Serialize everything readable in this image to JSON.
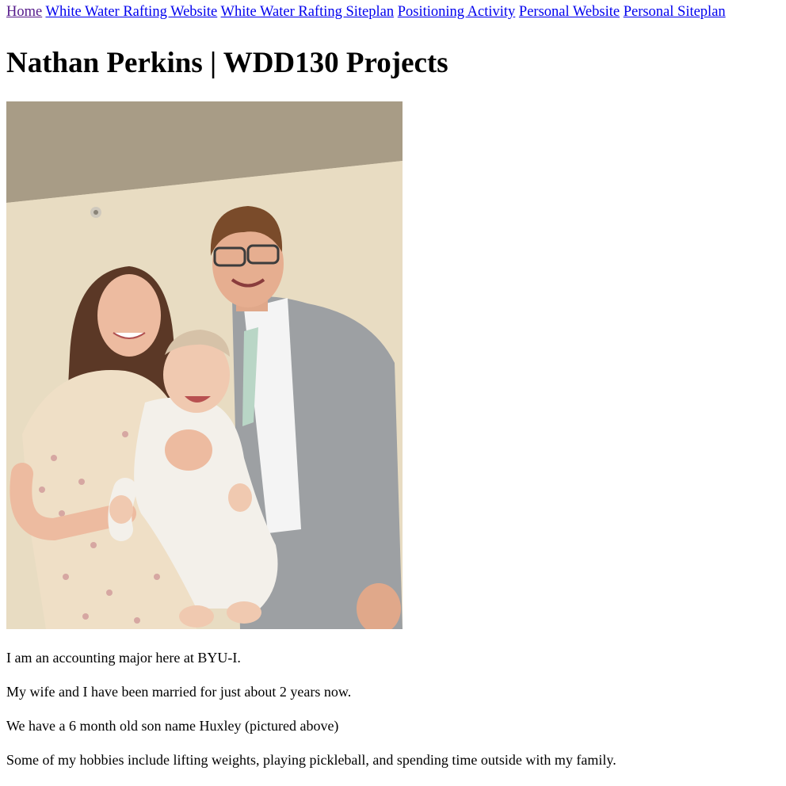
{
  "nav": {
    "links": [
      {
        "label": "Home",
        "visited": true
      },
      {
        "label": "White Water Rafting Website",
        "visited": false
      },
      {
        "label": "White Water Rafting Siteplan",
        "visited": false
      },
      {
        "label": "Positioning Activity",
        "visited": false
      },
      {
        "label": "Personal Website",
        "visited": false
      },
      {
        "label": "Personal Siteplan",
        "visited": false
      }
    ]
  },
  "page_title": "Nathan Perkins | WDD130 Projects",
  "photo": {
    "icon": "family-photo"
  },
  "paragraphs": [
    "I am an accounting major here at BYU-I.",
    "My wife and I have been married for just about 2 years now.",
    "We have a 6 month old son name Huxley (pictured above)",
    "Some of my hobbies include lifting weights, playing pickleball, and spending time outside with my family."
  ],
  "colors": {
    "link": "#0000ee",
    "visited_link": "#551a8b"
  }
}
